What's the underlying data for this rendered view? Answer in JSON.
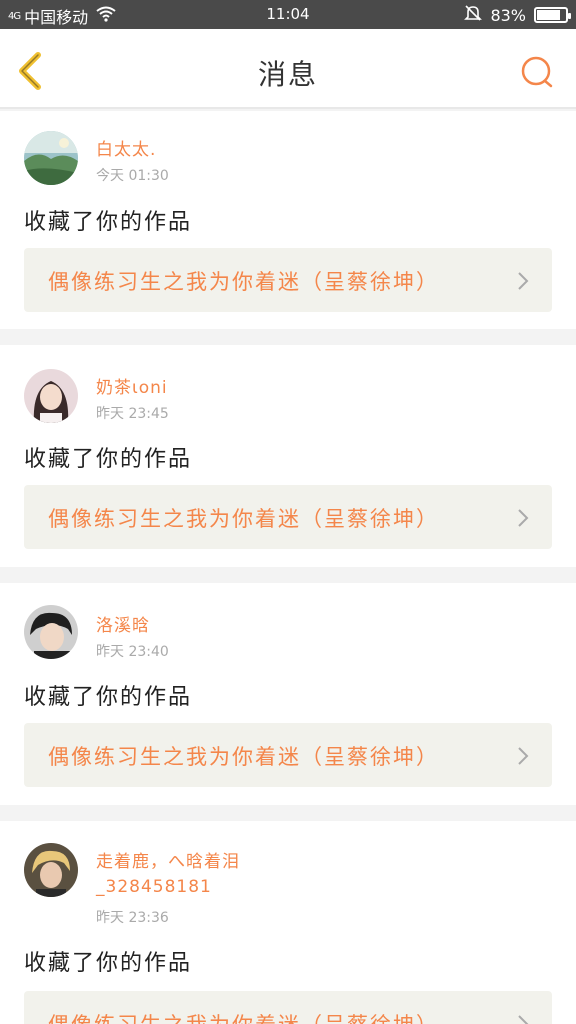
{
  "status_bar": {
    "signal_text": "4G",
    "carrier": "中国移动",
    "time": "11:04",
    "battery_text": "83%",
    "battery_level": 0.83
  },
  "header": {
    "title": "消息"
  },
  "messages": [
    {
      "username": "白太太.",
      "username_line2": "",
      "time": "今天 01:30",
      "action": "收藏了你的作品",
      "work_title": "偶像练习生之我为你着迷（呈蔡徐坤）"
    },
    {
      "username": "奶茶ιοni",
      "username_line2": "",
      "time": "昨天 23:45",
      "action": "收藏了你的作品",
      "work_title": "偶像练习生之我为你着迷（呈蔡徐坤）"
    },
    {
      "username": "洛溪晗",
      "username_line2": "",
      "time": "昨天 23:40",
      "action": "收藏了你的作品",
      "work_title": "偶像练习生之我为你着迷（呈蔡徐坤）"
    },
    {
      "username": "走着鹿，へ晗着泪",
      "username_line2": "_328458181",
      "time": "昨天 23:36",
      "action": "收藏了你的作品",
      "work_title": "偶像练习生之我为你着迷（呈蔡徐坤）"
    }
  ],
  "colors": {
    "accent": "#f4864a",
    "back_arrow": "#f0c030",
    "status_bar": "#4a4a4a",
    "work_box": "#f2f2ec"
  }
}
